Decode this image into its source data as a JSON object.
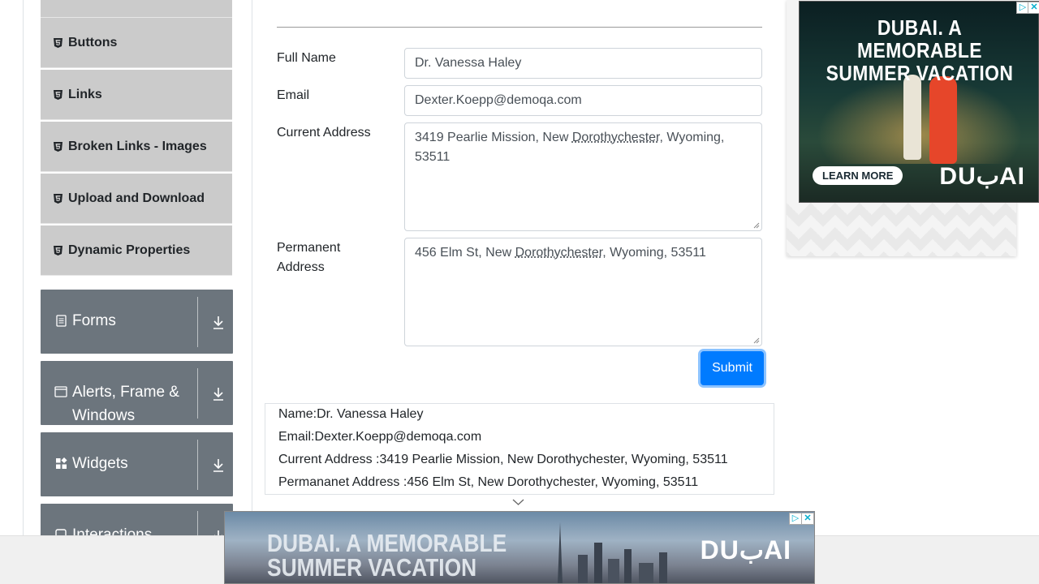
{
  "sidebar": {
    "elements_items": [
      {
        "label": "Buttons",
        "icon": "html5-icon"
      },
      {
        "label": "Links",
        "icon": "html5-icon"
      },
      {
        "label": "Broken Links - Images",
        "icon": "html5-icon"
      },
      {
        "label": "Upload and Download",
        "icon": "html5-icon"
      },
      {
        "label": "Dynamic Properties",
        "icon": "html5-icon"
      }
    ],
    "groups": [
      {
        "label": "Forms",
        "icon": "form-icon"
      },
      {
        "label": "Alerts, Frame & Windows",
        "line1": "Alerts, Frame &",
        "line2": "Windows",
        "icon": "window-icon"
      },
      {
        "label": "Widgets",
        "icon": "widgets-icon"
      },
      {
        "label": "Interactions",
        "icon": "interactions-icon"
      }
    ]
  },
  "form": {
    "full_name_label": "Full Name",
    "full_name_value": "Dr. Vanessa Haley",
    "email_label": "Email",
    "email_value": "Dexter.Koepp@demoqa.com",
    "current_address_label": "Current Address",
    "current_address_value": {
      "pre": "3419 Pearlie Mission, New ",
      "mark": "Dorothychester",
      "post": ", Wyoming, 53511"
    },
    "permanent_address_label_1": "Permanent",
    "permanent_address_label_2": "Address",
    "permanent_address_value": {
      "pre": "456 Elm St, New ",
      "mark": "Dorothychester",
      "post": ", Wyoming, 53511"
    },
    "submit_label": "Submit"
  },
  "output": {
    "name": "Name:Dr. Vanessa Haley",
    "email": "Email:Dexter.Koepp@demoqa.com",
    "current_address": "Current Address :3419 Pearlie Mission, New Dorothychester, Wyoming, 53511",
    "permanent_address": "Permananet Address :456 Elm St, New Dorothychester, Wyoming, 53511"
  },
  "ads": {
    "top_headline_1": "DUBAI. A MEMORABLE",
    "top_headline_2": "SUMMER VACATION",
    "top_cta": "LEARN MORE",
    "top_brand": "DUبAI",
    "bottom_headline_1": "DUBAI. A MEMORABLE",
    "bottom_headline_2": "SUMMER VACATION",
    "bottom_brand": "DUبAI",
    "adchoices_icon": "adchoices-icon",
    "close_icon": "close-icon"
  },
  "colors": {
    "sidebar_item_bg": "#cbcbcb",
    "group_bg": "#6c757d",
    "submit_bg": "#007bff"
  }
}
